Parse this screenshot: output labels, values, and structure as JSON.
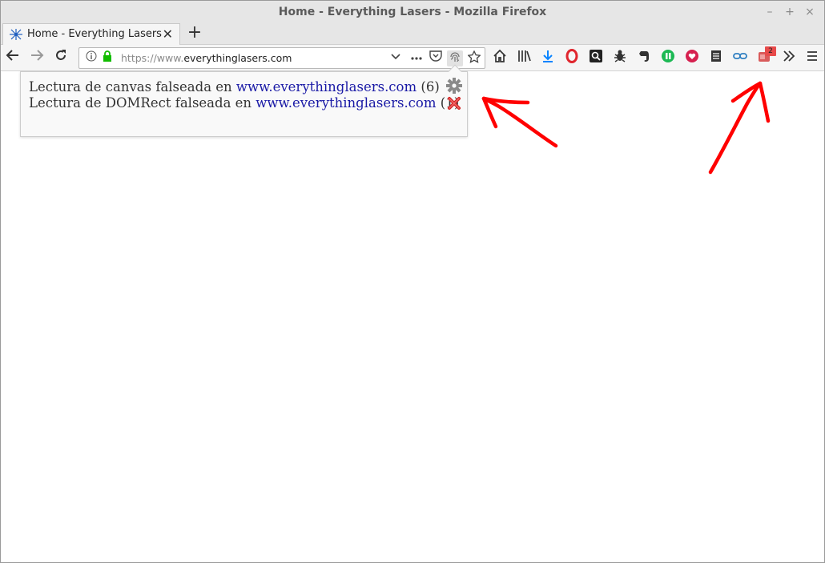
{
  "window": {
    "title": "Home - Everything Lasers - Mozilla Firefox",
    "controls": {
      "minimize": "–",
      "maximize": "+",
      "close": "×"
    }
  },
  "tabs": [
    {
      "label": "Home - Everything Lasers",
      "close": "✕"
    }
  ],
  "new_tab_label": "+",
  "url": {
    "scheme": "https://www.",
    "domain": "everythinglasers.com"
  },
  "popup": {
    "line1": {
      "prefix": "Lectura de canvas falseada en ",
      "link": "www.everythinglasers.com",
      "count": " (6)"
    },
    "line2": {
      "prefix": "Lectura de DOMRect falseada en ",
      "link": "www.everythinglasers.com",
      "count": " (1)"
    }
  },
  "toolbar_badge": "2",
  "icons": {
    "back": "back-arrow-icon",
    "forward": "forward-arrow-icon",
    "reload": "reload-icon",
    "info": "info-icon",
    "lock": "lock-icon",
    "dropdown": "chevron-down-icon",
    "more": "page-actions-icon",
    "pocket": "pocket-icon",
    "fingerprint": "fingerprint-icon",
    "bookmark": "star-icon",
    "home": "home-icon",
    "library": "library-icon",
    "download": "download-icon",
    "opera": "opera-icon",
    "search_ext": "magnifier-icon",
    "bug": "bug-icon",
    "evernote": "evernote-icon",
    "green_ext": "green-circle-icon",
    "pocket_red": "red-heart-circle-icon",
    "notes": "notes-icon",
    "link": "link-icon",
    "canvasblocker": "canvasblocker-icon",
    "overflow": "double-chevron-icon",
    "menu": "hamburger-menu-icon",
    "gear": "gear-icon",
    "redx": "red-x-icon"
  },
  "colors": {
    "link": "#1a1aa6",
    "annotation": "#ff0000",
    "badge": "#e84a4a",
    "download": "#0a84ff"
  }
}
